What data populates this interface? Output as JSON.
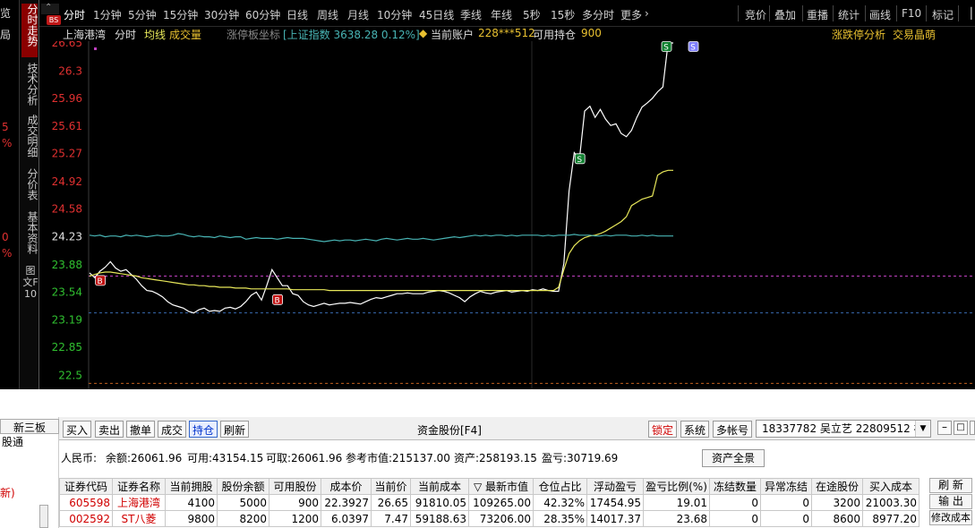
{
  "left_strip": {
    "items": [
      "览",
      "局",
      "5",
      "%",
      "0",
      "%"
    ]
  },
  "vertical_tabs": [
    "分时走势",
    "技术分析",
    "成交明细",
    "分价表",
    "基本资料",
    "图文F10"
  ],
  "bs_badge": "BS",
  "toolbar": {
    "periods": [
      "分时",
      "1分钟",
      "5分钟",
      "15分钟",
      "30分钟",
      "60分钟",
      "日线",
      "周线",
      "月线",
      "10分钟",
      "45日线",
      "季线",
      "年线",
      "5秒",
      "15秒",
      "多分时",
      "更多"
    ],
    "right": [
      "竞价",
      "叠加",
      "重播",
      "统计",
      "画线",
      "F10",
      "标记"
    ]
  },
  "infobar": {
    "stock_name": "上海港湾",
    "mode": "分时",
    "avg_line": "均线",
    "volume": "成交量",
    "coord": "涨停板坐标",
    "index": "[上证指数 3638.28 0.12%]",
    "account_label": "当前账户",
    "account": "228***512",
    "hold_label": "可用持仓",
    "hold": "900",
    "analysis": "涨跌停分析",
    "summary": "交易晶萌"
  },
  "chart_data": {
    "type": "line",
    "y_ticks": [
      26.65,
      26.3,
      25.96,
      25.61,
      25.27,
      24.92,
      24.58,
      24.23,
      23.88,
      23.54,
      23.19,
      22.85,
      22.5
    ],
    "ylim": [
      22.36,
      26.65
    ],
    "reference_line": 24.23,
    "series": [
      {
        "color": "#ffffff",
        "values": [
          23.78,
          23.72,
          23.8,
          23.85,
          23.92,
          23.84,
          23.8,
          23.82,
          23.76,
          23.7,
          23.62,
          23.56,
          23.55,
          23.52,
          23.48,
          23.42,
          23.38,
          23.36,
          23.34,
          23.3,
          23.28,
          23.32,
          23.34,
          23.3,
          23.31,
          23.3,
          23.34,
          23.35,
          23.33,
          23.36,
          23.42,
          23.5,
          23.54,
          23.44,
          23.62,
          23.82,
          23.72,
          23.62,
          23.62,
          23.52,
          23.5,
          23.42,
          23.38,
          23.36,
          23.38,
          23.4,
          23.38,
          23.39,
          23.4,
          23.4,
          23.41,
          23.4,
          23.39,
          23.42,
          23.45,
          23.47,
          23.46,
          23.48,
          23.5,
          23.52,
          23.52,
          23.53,
          23.52,
          23.52,
          23.52,
          23.54,
          23.55,
          23.56,
          23.55,
          23.53,
          23.5,
          23.47,
          23.42,
          23.48,
          23.52,
          23.55,
          23.53,
          23.52,
          23.54,
          23.55,
          23.56,
          23.54,
          23.55,
          23.56,
          23.55,
          23.57,
          23.56,
          23.58,
          23.56,
          23.55,
          23.55,
          23.9,
          24.8,
          25.28,
          25.2,
          25.8,
          25.86,
          25.72,
          25.82,
          25.7,
          25.62,
          25.64,
          25.52,
          25.48,
          25.56,
          25.72,
          25.85,
          25.9,
          25.96,
          26.04,
          26.1,
          26.65,
          26.65
        ]
      },
      {
        "color": "#e8e85a",
        "values": [
          23.74,
          23.76,
          23.78,
          23.79,
          23.79,
          23.78,
          23.77,
          23.76,
          23.75,
          23.74,
          23.72,
          23.71,
          23.7,
          23.69,
          23.68,
          23.67,
          23.66,
          23.65,
          23.64,
          23.63,
          23.63,
          23.62,
          23.62,
          23.61,
          23.61,
          23.6,
          23.6,
          23.6,
          23.59,
          23.59,
          23.59,
          23.58,
          23.58,
          23.58,
          23.58,
          23.58,
          23.58,
          23.58,
          23.58,
          23.57,
          23.57,
          23.57,
          23.57,
          23.57,
          23.57,
          23.57,
          23.56,
          23.56,
          23.56,
          23.56,
          23.56,
          23.56,
          23.56,
          23.56,
          23.56,
          23.56,
          23.56,
          23.56,
          23.56,
          23.56,
          23.56,
          23.56,
          23.56,
          23.56,
          23.56,
          23.56,
          23.56,
          23.56,
          23.56,
          23.56,
          23.56,
          23.56,
          23.56,
          23.56,
          23.56,
          23.56,
          23.56,
          23.56,
          23.56,
          23.56,
          23.56,
          23.56,
          23.56,
          23.56,
          23.56,
          23.56,
          23.56,
          23.56,
          23.56,
          23.56,
          23.6,
          23.82,
          24.02,
          24.12,
          24.18,
          24.22,
          24.24,
          24.25,
          24.27,
          24.3,
          24.34,
          24.38,
          24.42,
          24.48,
          24.62,
          24.66,
          24.7,
          24.72,
          24.74,
          25.0,
          25.04,
          25.06,
          25.06
        ]
      },
      {
        "color": "#48b4b4",
        "values": [
          24.25,
          24.24,
          24.25,
          24.23,
          24.24,
          24.24,
          24.23,
          24.25,
          24.24,
          24.25,
          24.24,
          24.23,
          24.24,
          24.25,
          24.24,
          24.24,
          24.25,
          24.27,
          24.26,
          24.24,
          24.23,
          24.24,
          24.23,
          24.23,
          24.22,
          24.24,
          24.23,
          24.22,
          24.23,
          24.23,
          24.2,
          24.21,
          24.22,
          24.21,
          24.21,
          24.21,
          24.2,
          24.21,
          24.22,
          24.21,
          24.21,
          24.21,
          24.2,
          24.19,
          24.18,
          24.17,
          24.18,
          24.19,
          24.18,
          24.19,
          24.19,
          24.18,
          24.19,
          24.2,
          24.19,
          24.18,
          24.2,
          24.21,
          24.2,
          24.19,
          24.2,
          24.21,
          24.2,
          24.2,
          24.21,
          24.2,
          24.19,
          24.2,
          24.21,
          24.22,
          24.23,
          24.22,
          24.23,
          24.24,
          24.25,
          24.24,
          24.25,
          24.24,
          24.25,
          24.25,
          24.24,
          24.25,
          24.24,
          24.25,
          24.25,
          24.25,
          24.25,
          24.24,
          24.25,
          24.24,
          24.25,
          24.25,
          24.25,
          24.26,
          24.25,
          24.25,
          24.25,
          24.24,
          24.24,
          24.25,
          24.24,
          24.25,
          24.25,
          24.25,
          24.24,
          24.24,
          24.25,
          24.24,
          24.25,
          24.24,
          24.24,
          24.24,
          24.24
        ]
      }
    ],
    "h_lines": [
      {
        "value": 23.74,
        "color": "#c040c0"
      },
      {
        "value": 23.28,
        "color": "#3a6ab0"
      },
      {
        "value": 22.4,
        "color": "#c06020"
      }
    ],
    "markers": [
      {
        "label": "B",
        "idx": 2,
        "value": 23.68,
        "color": "#c01010"
      },
      {
        "label": "B",
        "idx": 36,
        "value": 23.44,
        "color": "#c01010"
      },
      {
        "label": "S",
        "idx": 94,
        "value": 25.2,
        "color": "#108030"
      },
      {
        "label": "S",
        "idx": 111,
        "value": 26.6,
        "color": "#108030"
      },
      {
        "label": "S",
        "idx": 118,
        "value": 26.6,
        "color": "#8080ff"
      }
    ]
  },
  "trade": {
    "left_items": [
      "新三板",
      "股通",
      "新)"
    ],
    "buttons": [
      "买入",
      "卖出",
      "撤单",
      "成交",
      "持仓",
      "刷新"
    ],
    "center_title": "资金股份[F4]",
    "right_buttons": [
      "锁定",
      "系统",
      "多帐号"
    ],
    "account_select": "18337782  吴立艺 22809512 福",
    "currency": "人民币:",
    "balance": "余额:26061.96",
    "available": "可用:43154.15",
    "withdrawable": "可取:26061.96",
    "market_value": "参考市值:215137.00",
    "assets": "资产:258193.15",
    "pnl": "盈亏:30719.69",
    "assets_all": "资产全景",
    "headers": [
      "证券代码",
      "证券名称",
      "当前拥股",
      "股份余额",
      "可用股份",
      "成本价",
      "当前价",
      "当前成本",
      "▽ 最新市值",
      "仓位占比",
      "浮动盈亏",
      "盈亏比例(%)",
      "冻结数量",
      "异常冻结",
      "在途股份",
      "买入成本"
    ],
    "rows": [
      [
        "605598",
        "上海港湾",
        "4100",
        "5000",
        "900",
        "22.3927",
        "26.65",
        "91810.05",
        "109265.00",
        "42.32%",
        "17454.95",
        "19.01",
        "0",
        "0",
        "3200",
        "21003.30"
      ],
      [
        "002592",
        "ST八菱",
        "9800",
        "8200",
        "1200",
        "6.0397",
        "7.47",
        "59188.63",
        "73206.00",
        "28.35%",
        "14017.37",
        "23.68",
        "0",
        "0",
        "8600",
        "8977.20"
      ]
    ],
    "side_buttons": [
      "刷 新",
      "输 出",
      "修改成本"
    ]
  }
}
